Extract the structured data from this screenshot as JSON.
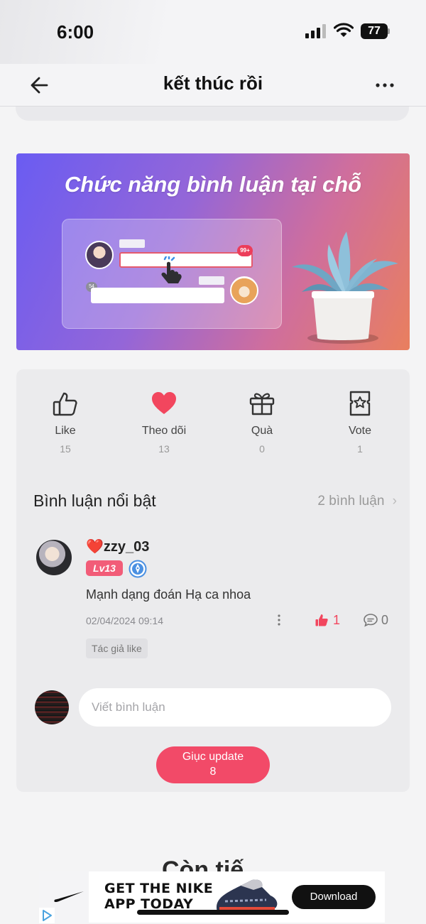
{
  "status_bar": {
    "time": "6:00",
    "battery": "77"
  },
  "nav": {
    "title": "kết thúc rồi"
  },
  "banner": {
    "title": "Chức năng bình luận tại chỗ",
    "badge": "99+",
    "count": "54",
    "colors": {
      "start": "#6a5cf2",
      "end": "#e97f5e"
    }
  },
  "actions": [
    {
      "label": "Like",
      "count": "15",
      "icon": "thumbs-up-icon"
    },
    {
      "label": "Theo dõi",
      "count": "13",
      "icon": "heart-icon"
    },
    {
      "label": "Quà",
      "count": "0",
      "icon": "gift-icon"
    },
    {
      "label": "Vote",
      "count": "1",
      "icon": "vote-ticket-icon"
    }
  ],
  "comments_section": {
    "title": "Bình luận nổi bật",
    "more": "2 bình luận"
  },
  "comment": {
    "user": "❤️zzy_03",
    "level": "Lv13",
    "text": "Mạnh dạng đoán Hạ ca nhoa",
    "date": "02/04/2024 09:14",
    "likes": "1",
    "replies": "0",
    "author_tag": "Tác giả like"
  },
  "comment_input": {
    "placeholder": "Viết bình luận"
  },
  "update_button": {
    "label": "Giục update",
    "count": "8"
  },
  "next_section": {
    "heading_partial": "Còn tiế"
  },
  "ad": {
    "line1": "GET THE NIKE",
    "line2": "APP TODAY",
    "cta": "Download"
  },
  "colors": {
    "accent": "#f24a68",
    "heart": "#f2465e",
    "level_badge": "#f25c78"
  }
}
